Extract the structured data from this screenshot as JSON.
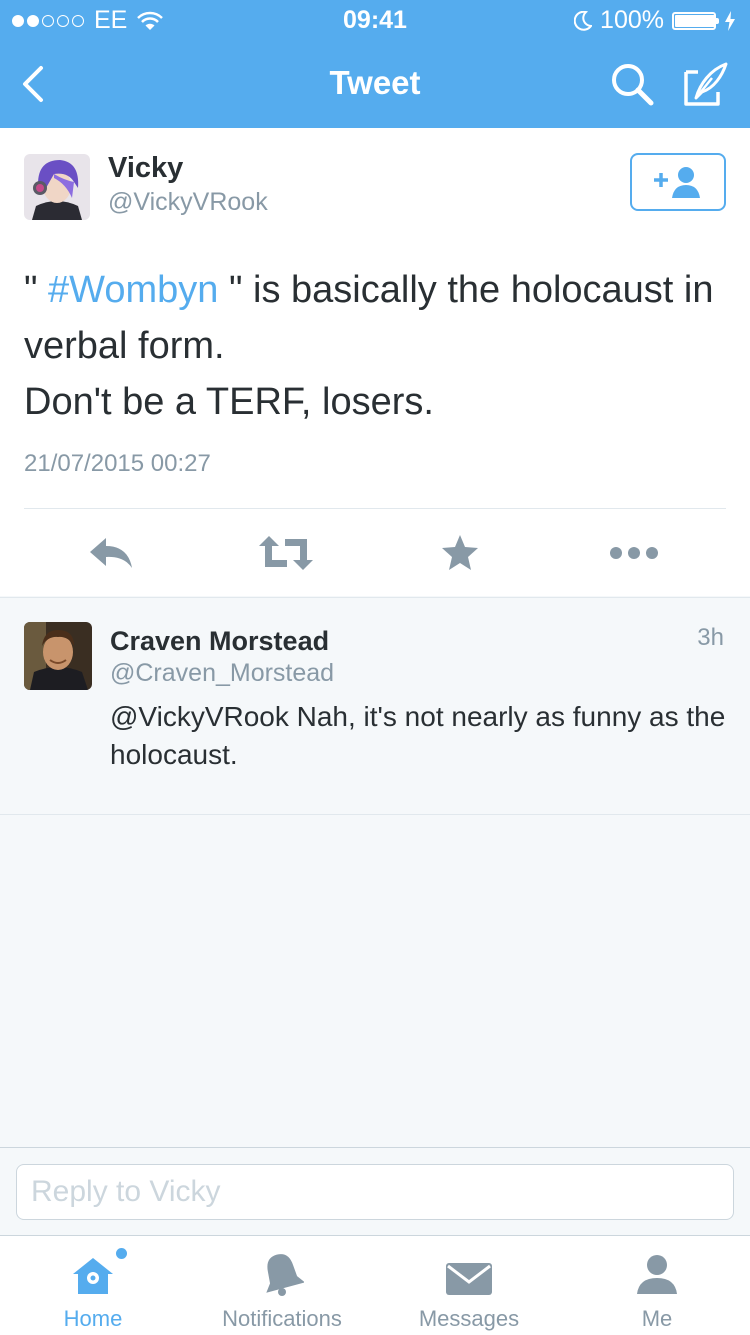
{
  "status_bar": {
    "carrier": "EE",
    "time": "09:41",
    "battery": "100%",
    "battery_level": 1.0
  },
  "nav": {
    "title": "Tweet",
    "back_icon": "chevron-left-icon",
    "search_icon": "search-icon",
    "compose_icon": "compose-icon"
  },
  "tweet": {
    "author_name": "Vicky",
    "author_handle": "@VickyVRook",
    "text_prefix": "\" ",
    "hashtag": "#Wombyn",
    "text_middle": " \" is basically the holocaust in verbal form.",
    "text_line2": "Don't be a TERF, losers.",
    "timestamp": "21/07/2015 00:27",
    "actions": [
      "reply-icon",
      "retweet-icon",
      "favorite-icon",
      "more-icon"
    ]
  },
  "reply": {
    "author_name": "Craven Morstead",
    "author_handle": "@Craven_Morstead",
    "time": "3h",
    "text": "@VickyVRook Nah, it's not nearly as funny as the holocaust."
  },
  "reply_bar": {
    "placeholder": "Reply to Vicky"
  },
  "tabs": [
    {
      "label": "Home",
      "icon": "home-icon",
      "active": true
    },
    {
      "label": "Notifications",
      "icon": "bell-icon",
      "active": false
    },
    {
      "label": "Messages",
      "icon": "envelope-icon",
      "active": false
    },
    {
      "label": "Me",
      "icon": "person-icon",
      "active": false
    }
  ],
  "colors": {
    "brand": "#55acee",
    "text": "#292f33",
    "secondary": "#8899a6",
    "background": "#f5f8fa"
  }
}
